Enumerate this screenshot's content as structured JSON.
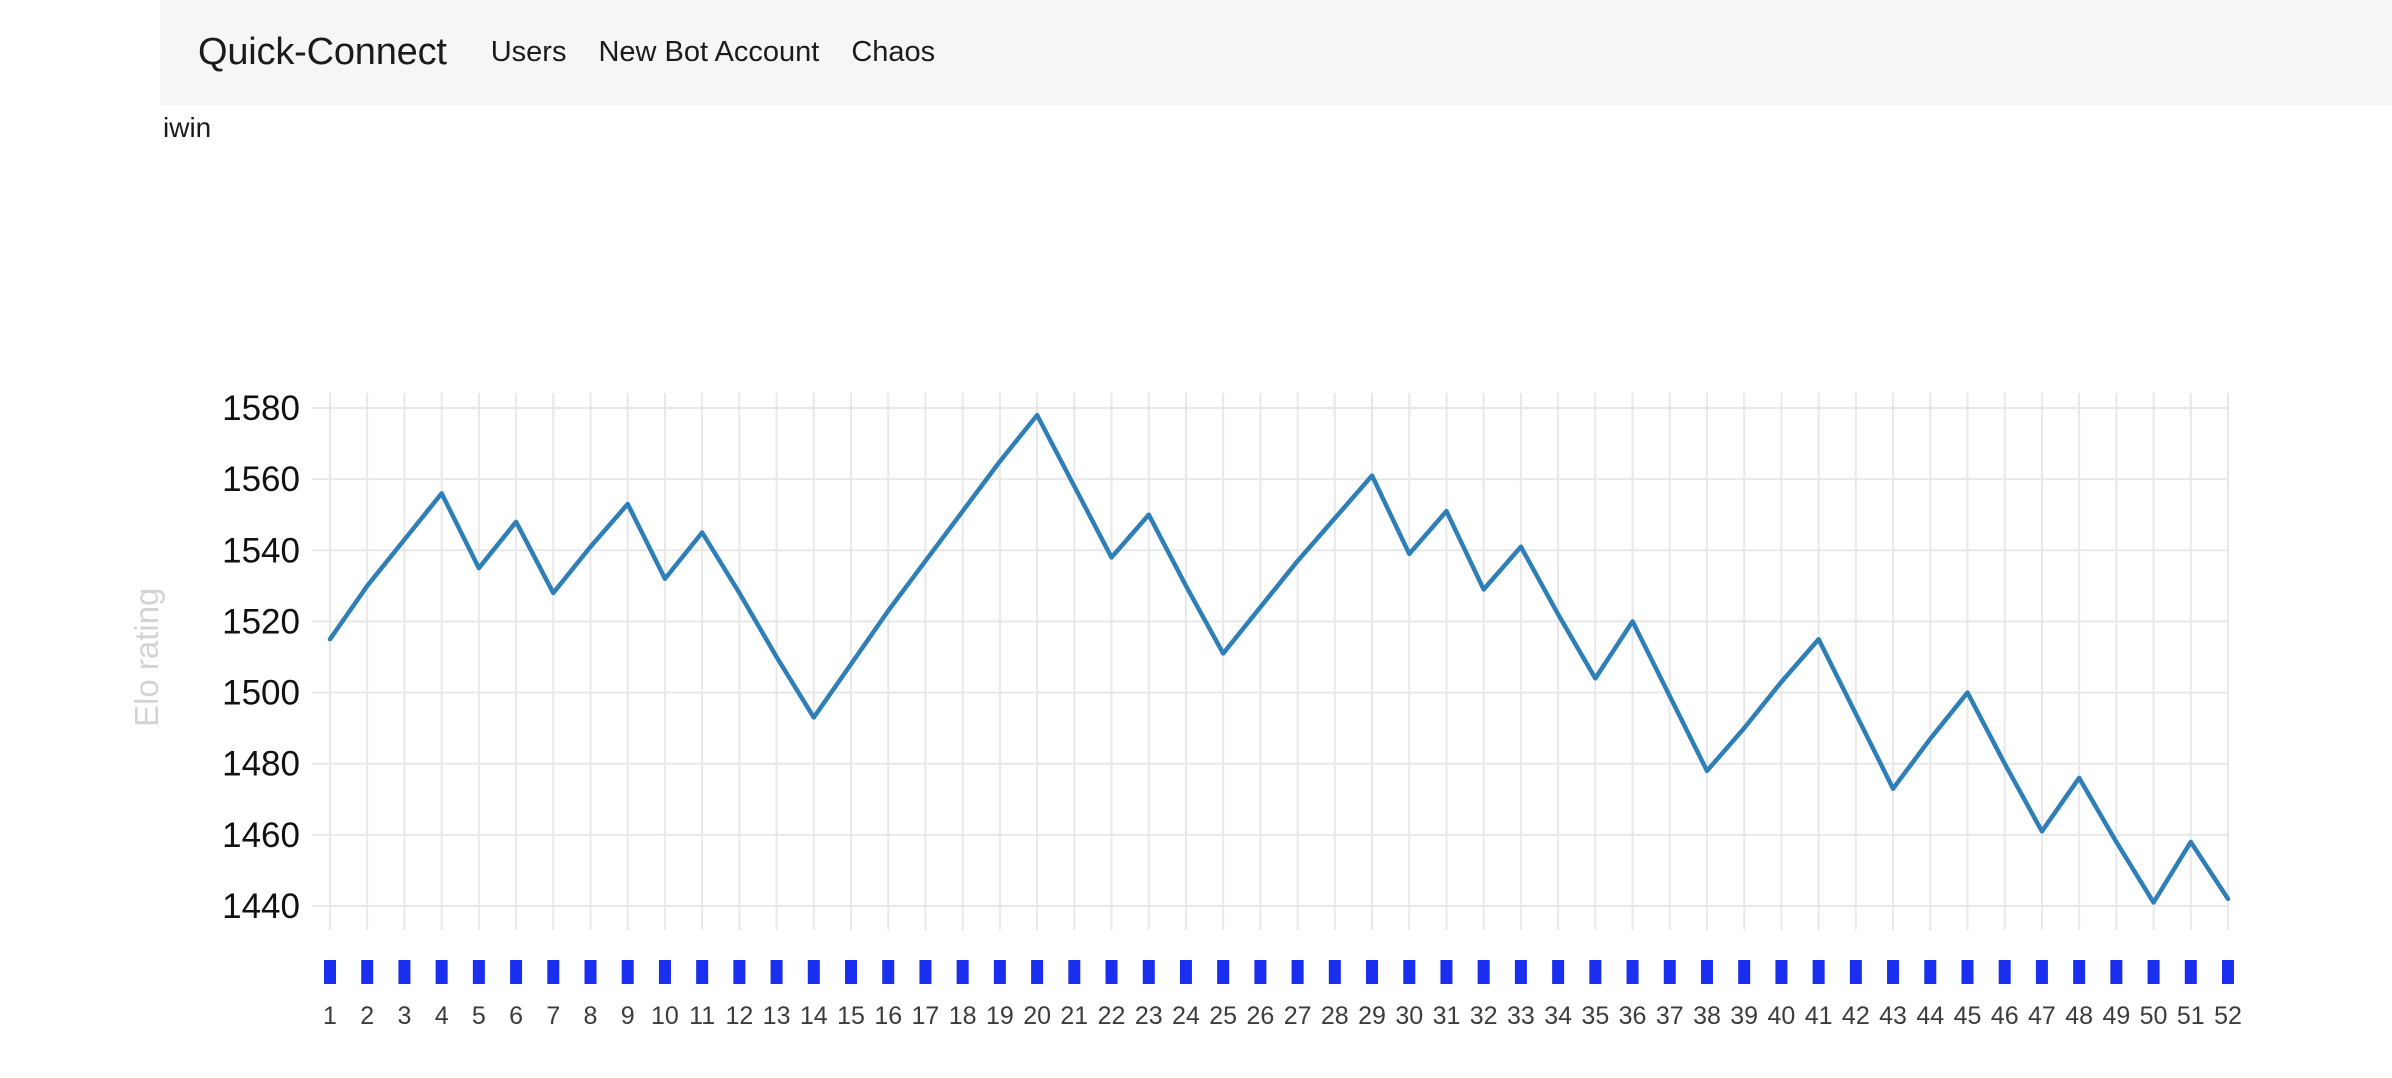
{
  "navbar": {
    "brand": "Quick-Connect",
    "links": [
      {
        "label": "Users"
      },
      {
        "label": "New Bot Account"
      },
      {
        "label": "Chaos"
      }
    ]
  },
  "page": {
    "username": "iwin"
  },
  "colors": {
    "navbar_bg": "#f6f6f6",
    "line": "#2e7fb8",
    "marker": "#1a2ef0",
    "grid": "#e8e8e8",
    "axis_label": "#d4d4d4",
    "tick_text": "#3c3c3c"
  },
  "chart_data": {
    "type": "line",
    "title": "",
    "xlabel": "",
    "ylabel": "Elo rating",
    "grid": true,
    "legend": "none",
    "ylim": [
      1440,
      1580
    ],
    "yticks": [
      1440,
      1460,
      1480,
      1500,
      1520,
      1540,
      1560,
      1580
    ],
    "xlim": [
      1,
      52
    ],
    "categories": [
      1,
      2,
      3,
      4,
      5,
      6,
      7,
      8,
      9,
      10,
      11,
      12,
      13,
      14,
      15,
      16,
      17,
      18,
      19,
      20,
      21,
      22,
      23,
      24,
      25,
      26,
      27,
      28,
      29,
      30,
      31,
      32,
      33,
      34,
      35,
      36,
      37,
      38,
      39,
      40,
      41,
      42,
      43,
      44,
      45,
      46,
      47,
      48,
      49,
      50,
      51,
      52
    ],
    "xticklabels": [
      "1",
      "2",
      "3",
      "4",
      "5",
      "6",
      "7",
      "8",
      "9",
      "10",
      "11",
      "12",
      "13",
      "14",
      "15",
      "16",
      "17",
      "18",
      "19",
      "20",
      "21",
      "22",
      "23",
      "24",
      "25",
      "26",
      "27",
      "28",
      "29",
      "30",
      "31",
      "32",
      "33",
      "34",
      "35",
      "36",
      "37",
      "38",
      "39",
      "40",
      "41",
      "42",
      "43",
      "44",
      "45",
      "46",
      "47",
      "48",
      "49",
      "50",
      "51",
      "52"
    ],
    "series": [
      {
        "name": "Elo rating",
        "values": [
          1515,
          1530,
          1543,
          1556,
          1535,
          1548,
          1528,
          1541,
          1553,
          1532,
          1545,
          1528,
          1510,
          1493,
          1508,
          1523,
          1537,
          1551,
          1565,
          1578,
          1558,
          1538,
          1550,
          1530,
          1511,
          1524,
          1537,
          1549,
          1561,
          1539,
          1551,
          1529,
          1541,
          1522,
          1504,
          1520,
          1499,
          1478,
          1490,
          1503,
          1515,
          1494,
          1473,
          1487,
          1500,
          1480,
          1461,
          1476,
          1458,
          1441,
          1458,
          1442
        ]
      }
    ]
  }
}
